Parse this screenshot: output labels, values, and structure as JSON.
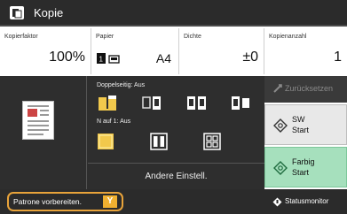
{
  "title_bar": {
    "title": "Kopie",
    "icon": "copy-app-icon"
  },
  "info": {
    "kopierfaktor": {
      "label": "Kopierfaktor",
      "value": "100%"
    },
    "papier": {
      "label": "Papier",
      "value": "A4",
      "icons": [
        "page-icon",
        "tray-icon"
      ]
    },
    "dichte": {
      "label": "Dichte",
      "value": "±0"
    },
    "kopienanzahl": {
      "label": "Kopienanzahl",
      "value": "1"
    }
  },
  "options": {
    "doppelseitig_label": "Doppelseitig: Aus",
    "n_auf_1_label": "N auf 1: Aus",
    "andere_label": "Andere Einstell."
  },
  "actions": {
    "zuruecksetzen": "Zurücksetzen",
    "sw_start": [
      "SW",
      "Start"
    ],
    "farbig_start": [
      "Farbig",
      "Start"
    ],
    "statusmonitor": "Statusmonitor"
  },
  "status_bar": {
    "message": "Patrone vorbereiten.",
    "badge": "Y"
  },
  "colors": {
    "dark_bg": "#2e2e2e",
    "farbig_green": "#a6e0bd",
    "warning_orange": "#e8a33a",
    "yellow_toner": "#f0b030"
  }
}
